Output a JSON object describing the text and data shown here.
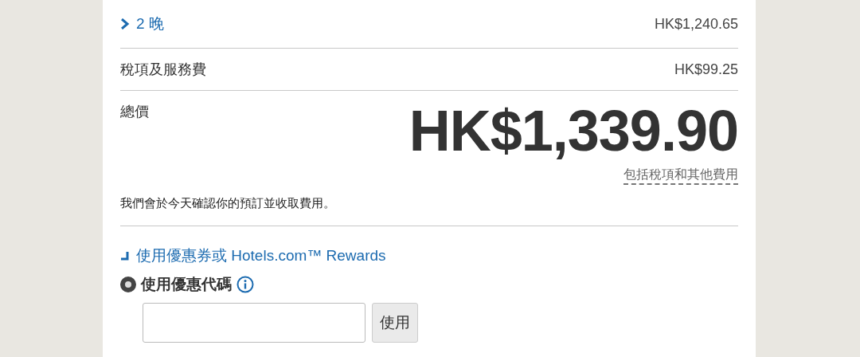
{
  "nights_row": {
    "label": "2 晚",
    "amount": "HK$1,240.65",
    "expanded": false
  },
  "tax_row": {
    "label": "稅項及服務費",
    "amount": "HK$99.25"
  },
  "total": {
    "label": "總價",
    "amount": "HK$1,339.90",
    "note": "包括稅項和其他費用"
  },
  "charge_notice": "我們會於今天確認你的預訂並收取費用。",
  "coupon_link": {
    "label": "使用優惠券或 Hotels.com™ Rewards",
    "expanded": true
  },
  "promo_option": {
    "label": "使用優惠代碼",
    "selected": true
  },
  "apply_button": "使用"
}
